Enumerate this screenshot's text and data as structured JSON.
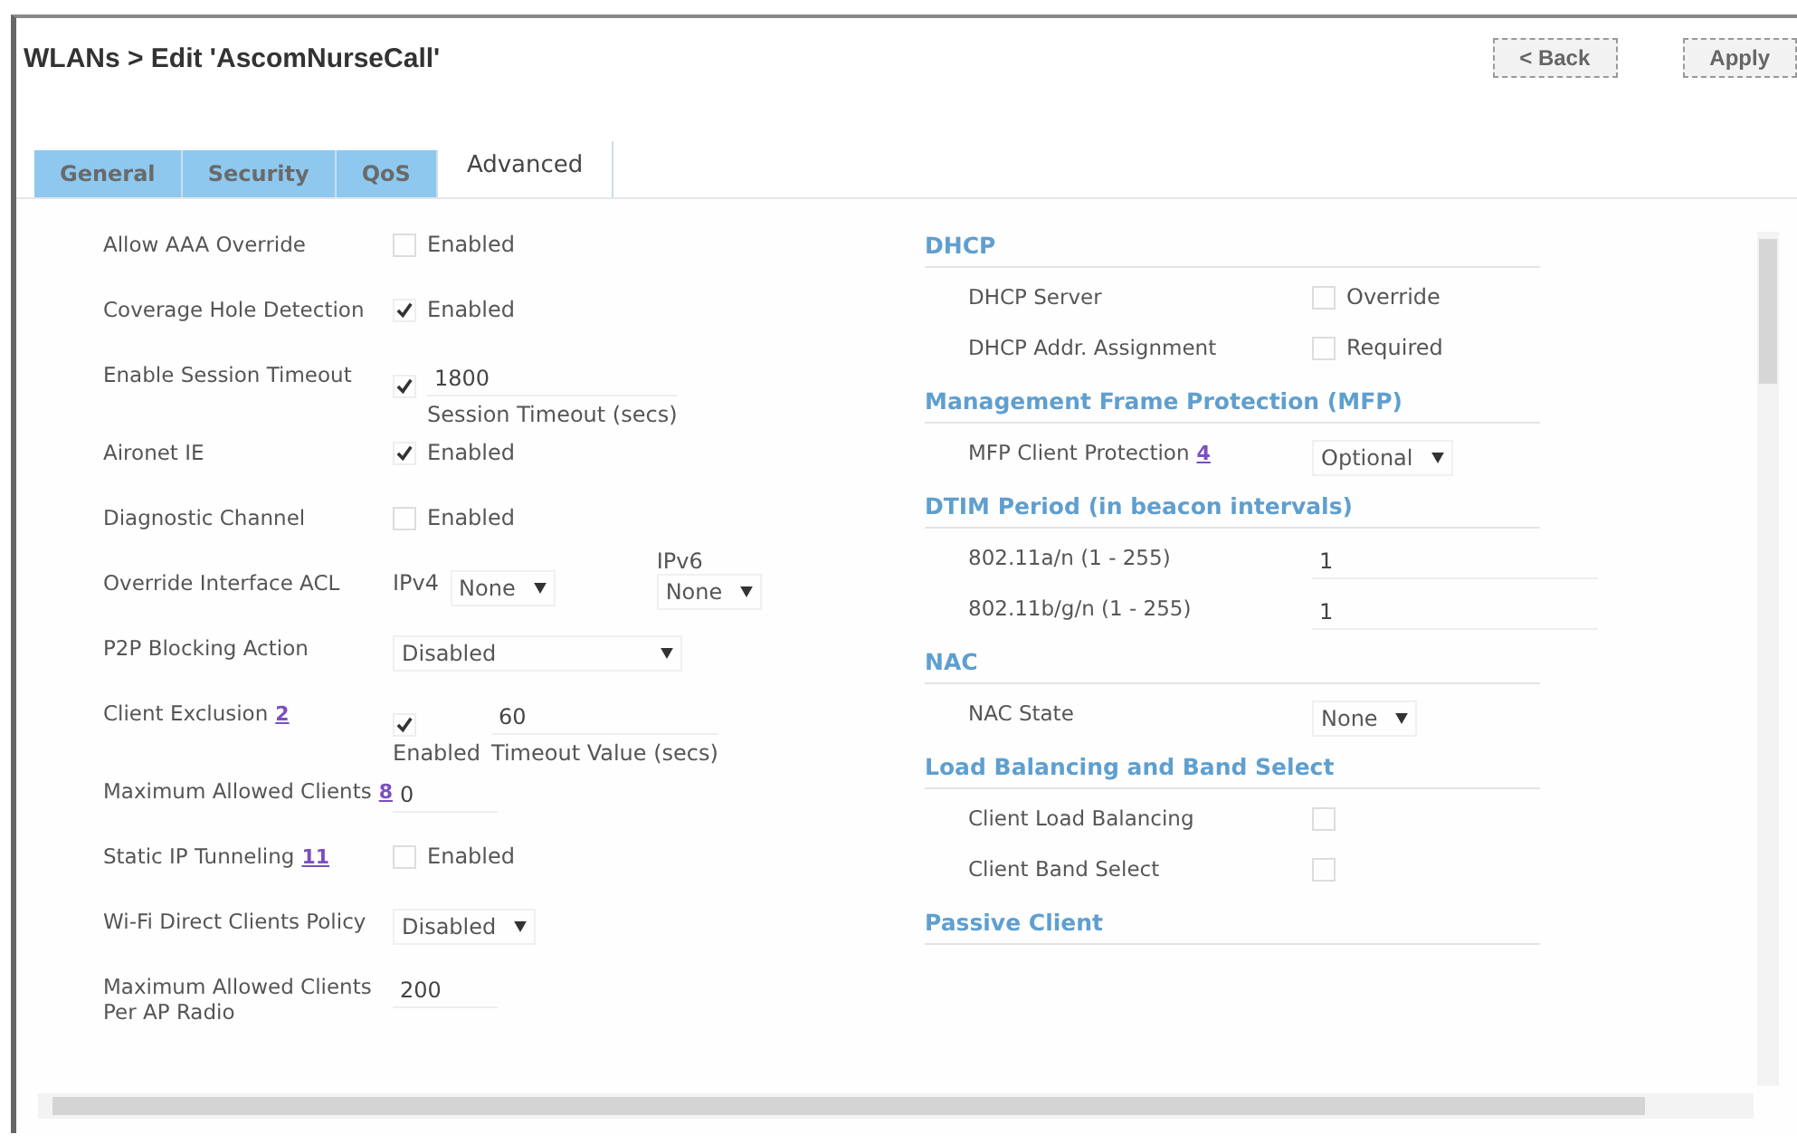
{
  "header": {
    "title": "WLANs > Edit  'AscomNurseCall'",
    "buttons": [
      "< Back",
      "Apply"
    ]
  },
  "tabs": [
    {
      "label": "General",
      "selected": false
    },
    {
      "label": "Security",
      "selected": false
    },
    {
      "label": "QoS",
      "selected": false
    },
    {
      "label": "Advanced",
      "selected": true
    }
  ],
  "left_rows": [
    {
      "kind": "checkbox",
      "label": "Allow AAA Override",
      "checked": false,
      "text": "Enabled"
    },
    {
      "kind": "checkbox",
      "label": "Coverage Hole Detection",
      "checked": true,
      "text": "Enabled"
    },
    {
      "kind": "checkbox_input",
      "label": "Enable Session Timeout",
      "checked": true,
      "value": "1800",
      "caption": "Session Timeout (secs)"
    },
    {
      "kind": "checkbox",
      "label": "Aironet IE",
      "checked": true,
      "text": "Enabled"
    },
    {
      "kind": "checkbox",
      "label": "Diagnostic Channel",
      "checked": false,
      "text": "Enabled"
    },
    {
      "kind": "acl",
      "label": "Override Interface ACL",
      "ipv4_label": "IPv4",
      "ipv4_value": "None",
      "ipv6_label": "IPv6",
      "ipv6_value": "None"
    },
    {
      "kind": "select",
      "label": "P2P Blocking Action",
      "value": "Disabled"
    },
    {
      "kind": "checkbox_input",
      "label": "Client Exclusion",
      "help": "2",
      "checked": true,
      "text": "Enabled",
      "value": "60",
      "caption": "Timeout Value (secs)"
    },
    {
      "kind": "input",
      "label": "Maximum Allowed Clients",
      "help": "8",
      "value": "0"
    },
    {
      "kind": "checkbox",
      "label": "Static IP Tunneling",
      "help": "11",
      "checked": false,
      "text": "Enabled"
    },
    {
      "kind": "select",
      "label": "Wi-Fi Direct Clients Policy",
      "value": "Disabled"
    },
    {
      "kind": "input",
      "label": "Maximum Allowed Clients Per AP Radio",
      "value": "200"
    }
  ],
  "right_sections": [
    {
      "title": "DHCP",
      "rows": [
        {
          "kind": "checkbox",
          "label": "DHCP Server",
          "checked": false,
          "text": "Override"
        },
        {
          "kind": "checkbox",
          "label": "DHCP Addr. Assignment",
          "checked": false,
          "text": "Required"
        }
      ]
    },
    {
      "title": "Management Frame Protection (MFP)",
      "rows": [
        {
          "kind": "select",
          "label": "MFP Client Protection",
          "help": "4",
          "value": "Optional"
        }
      ]
    },
    {
      "title": "DTIM Period (in beacon intervals)",
      "rows": [
        {
          "kind": "input",
          "label": "802.11a/n (1 - 255)",
          "value": "1"
        },
        {
          "kind": "input",
          "label": "802.11b/g/n (1 - 255)",
          "value": "1"
        }
      ]
    },
    {
      "title": "NAC",
      "rows": [
        {
          "kind": "select",
          "label": "NAC State",
          "value": "None"
        }
      ]
    },
    {
      "title": "Load Balancing and Band Select",
      "rows": [
        {
          "kind": "checkbox",
          "label": "Client Load Balancing",
          "checked": false
        },
        {
          "kind": "checkbox",
          "label": "Client Band Select",
          "checked": false
        }
      ]
    },
    {
      "title": "Passive Client"
    }
  ]
}
